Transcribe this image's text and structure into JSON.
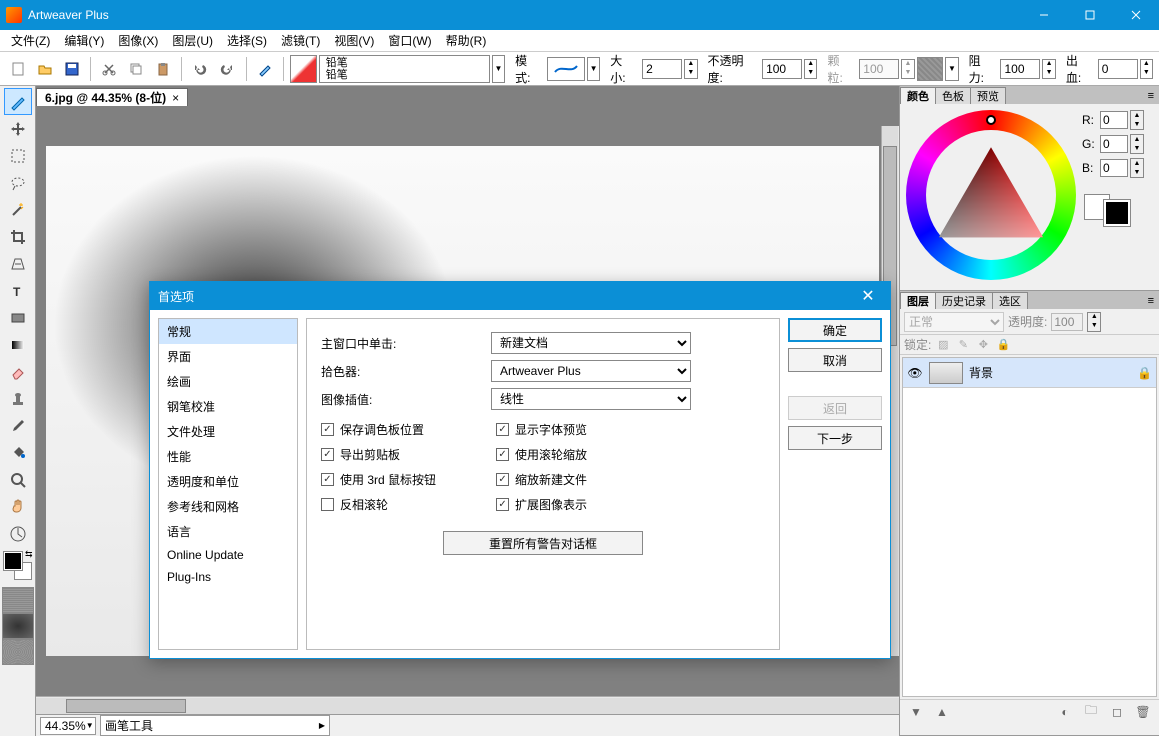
{
  "titlebar": {
    "app_title": "Artweaver Plus"
  },
  "menubar": {
    "items": [
      "文件(Z)",
      "编辑(Y)",
      "图像(X)",
      "图层(U)",
      "选择(S)",
      "滤镜(T)",
      "视图(V)",
      "窗口(W)",
      "帮助(R)"
    ]
  },
  "toolbar": {
    "tool_name_line1": "铅笔",
    "tool_name_line2": "铅笔",
    "mode_label": "模式:",
    "size_label": "大小:",
    "size_value": "2",
    "opacity_label": "不透明度:",
    "opacity_value": "100",
    "grain_label": "颗粒:",
    "grain_value": "100",
    "resat_label": "阻力:",
    "resat_value": "100",
    "bleed_label": "出血:",
    "bleed_value": "0"
  },
  "document": {
    "tab_title": "6.jpg @ 44.35% (8-位)",
    "zoom": "44.35%",
    "status_tool": "画笔工具"
  },
  "color_panel": {
    "tabs": [
      "颜色",
      "色板",
      "预览"
    ],
    "r_label": "R:",
    "g_label": "G:",
    "b_label": "B:",
    "r": "0",
    "g": "0",
    "b": "0"
  },
  "layers_panel": {
    "tabs": [
      "图层",
      "历史记录",
      "选区"
    ],
    "blend_mode": "正常",
    "opacity_label": "透明度:",
    "opacity_value": "100",
    "lock_label": "锁定:",
    "layer_name": "背景"
  },
  "dialog": {
    "title": "首选项",
    "categories": [
      "常规",
      "界面",
      "绘画",
      "钢笔校准",
      "文件处理",
      "性能",
      "透明度和单位",
      "参考线和网格",
      "语言",
      "Online Update",
      "Plug-Ins"
    ],
    "selected_index": 0,
    "row1_label": "主窗口中单击:",
    "row1_value": "新建文档",
    "row2_label": "拾色器:",
    "row2_value": "Artweaver Plus",
    "row3_label": "图像插值:",
    "row3_value": "线性",
    "checks_left": [
      {
        "label": "保存调色板位置",
        "checked": true
      },
      {
        "label": "导出剪贴板",
        "checked": true
      },
      {
        "label": "使用 3rd 鼠标按钮",
        "checked": true
      },
      {
        "label": "反相滚轮",
        "checked": false
      }
    ],
    "checks_right": [
      {
        "label": "显示字体预览",
        "checked": true
      },
      {
        "label": "使用滚轮缩放",
        "checked": true
      },
      {
        "label": "缩放新建文件",
        "checked": true
      },
      {
        "label": "扩展图像表示",
        "checked": true
      }
    ],
    "reset_btn": "重置所有警告对话框",
    "ok": "确定",
    "cancel": "取消",
    "back": "返回",
    "next": "下一步"
  }
}
